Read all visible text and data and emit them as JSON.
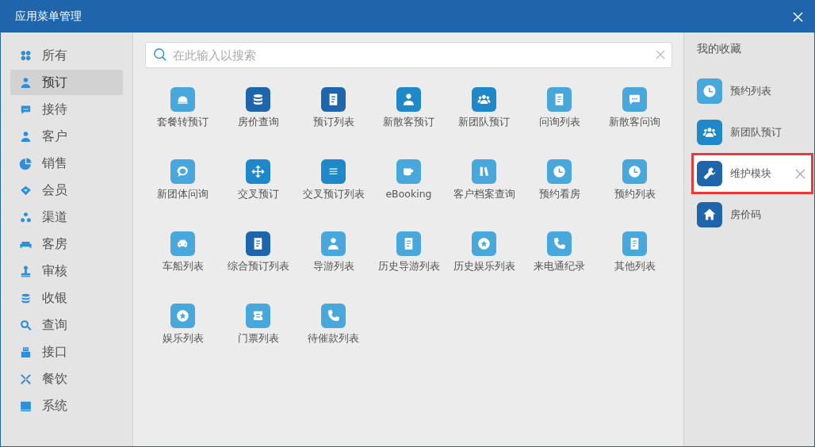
{
  "window": {
    "title": "应用菜单管理"
  },
  "sidebar": {
    "items": [
      {
        "label": "所有",
        "selected": false
      },
      {
        "label": "预订",
        "selected": true
      },
      {
        "label": "接待",
        "selected": false
      },
      {
        "label": "客户",
        "selected": false
      },
      {
        "label": "销售",
        "selected": false
      },
      {
        "label": "会员",
        "selected": false
      },
      {
        "label": "渠道",
        "selected": false
      },
      {
        "label": "客房",
        "selected": false
      },
      {
        "label": "审核",
        "selected": false
      },
      {
        "label": "收银",
        "selected": false
      },
      {
        "label": "查询",
        "selected": false
      },
      {
        "label": "接口",
        "selected": false
      },
      {
        "label": "餐饮",
        "selected": false
      },
      {
        "label": "系统",
        "selected": false
      }
    ]
  },
  "search": {
    "placeholder": "在此输入以搜索"
  },
  "apps": [
    {
      "label": "套餐转预订",
      "color": "#48a8dc"
    },
    {
      "label": "房价查询",
      "color": "#1f65ab"
    },
    {
      "label": "预订列表",
      "color": "#1f65ab"
    },
    {
      "label": "新散客预订",
      "color": "#1e88c8"
    },
    {
      "label": "新团队预订",
      "color": "#1e88c8"
    },
    {
      "label": "问询列表",
      "color": "#48a8dc"
    },
    {
      "label": "新散客问询",
      "color": "#48a8dc"
    },
    {
      "label": "新团体问询",
      "color": "#48a8dc"
    },
    {
      "label": "交叉预订",
      "color": "#1e88c8"
    },
    {
      "label": "交叉预订列表",
      "color": "#1e88c8"
    },
    {
      "label": "eBooking",
      "color": "#48a8dc"
    },
    {
      "label": "客户档案查询",
      "color": "#48a8dc"
    },
    {
      "label": "预约看房",
      "color": "#48a8dc"
    },
    {
      "label": "预约列表",
      "color": "#48a8dc"
    },
    {
      "label": "车船列表",
      "color": "#48a8dc"
    },
    {
      "label": "综合预订列表",
      "color": "#1f65ab"
    },
    {
      "label": "导游列表",
      "color": "#48a8dc"
    },
    {
      "label": "历史导游列表",
      "color": "#48a8dc"
    },
    {
      "label": "历史娱乐列表",
      "color": "#48a8dc"
    },
    {
      "label": "来电通纪录",
      "color": "#48a8dc"
    },
    {
      "label": "其他列表",
      "color": "#48a8dc"
    },
    {
      "label": "娱乐列表",
      "color": "#48a8dc"
    },
    {
      "label": "门票列表",
      "color": "#48a8dc"
    },
    {
      "label": "待催款列表",
      "color": "#48a8dc"
    }
  ],
  "favorites": {
    "title": "我的收藏",
    "items": [
      {
        "label": "预约列表",
        "color": "#48a8dc",
        "selected": false
      },
      {
        "label": "新团队预订",
        "color": "#1e88c8",
        "selected": false
      },
      {
        "label": "维护模块",
        "color": "#1f65ab",
        "selected": true
      },
      {
        "label": "房价码",
        "color": "#1f65ab",
        "selected": false
      }
    ]
  }
}
